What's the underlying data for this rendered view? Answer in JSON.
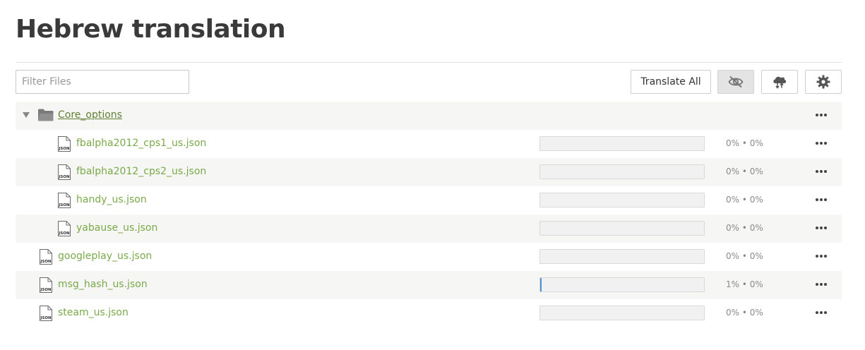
{
  "header": {
    "title": "Hebrew translation"
  },
  "toolbar": {
    "filter_placeholder": "Filter Files",
    "translate_all_label": "Translate All",
    "hide_icon": "eye-slash-icon",
    "cloud_icon": "cloud-sync-icon",
    "settings_icon": "gear-icon"
  },
  "folder": {
    "name": "Core_options",
    "expanded": true
  },
  "files": [
    {
      "name": "fbalpha2012_cps1_us.json",
      "in_folder": true,
      "progress": 0,
      "stats": "0% • 0%"
    },
    {
      "name": "fbalpha2012_cps2_us.json",
      "in_folder": true,
      "progress": 0,
      "stats": "0% • 0%"
    },
    {
      "name": "handy_us.json",
      "in_folder": true,
      "progress": 0,
      "stats": "0% • 0%"
    },
    {
      "name": "yabause_us.json",
      "in_folder": true,
      "progress": 0,
      "stats": "0% • 0%"
    },
    {
      "name": "googleplay_us.json",
      "in_folder": false,
      "progress": 0,
      "stats": "0% • 0%"
    },
    {
      "name": "msg_hash_us.json",
      "in_folder": false,
      "progress": 1,
      "stats": "1% • 0%"
    },
    {
      "name": "steam_us.json",
      "in_folder": false,
      "progress": 0,
      "stats": "0% • 0%"
    }
  ],
  "colors": {
    "link_green": "#7aa94a",
    "folder_green": "#5f7f32",
    "progress_blue": "#4a90d9"
  }
}
